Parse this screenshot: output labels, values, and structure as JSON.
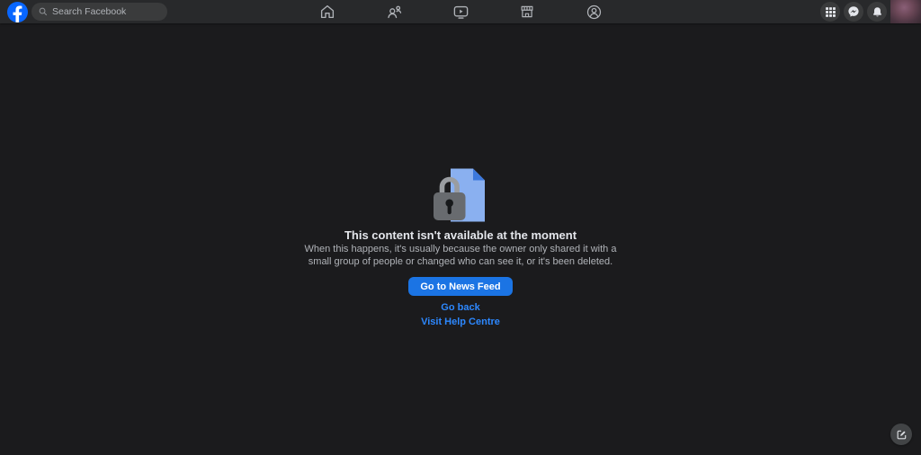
{
  "navbar": {
    "logo": "facebook",
    "search": {
      "placeholder": "Search Facebook"
    },
    "tabs": [
      {
        "icon": "home-icon"
      },
      {
        "icon": "friends-icon"
      },
      {
        "icon": "watch-icon"
      },
      {
        "icon": "marketplace-icon"
      },
      {
        "icon": "groups-icon"
      }
    ],
    "right_controls": [
      {
        "icon": "menu-grid-icon"
      },
      {
        "icon": "messenger-icon"
      },
      {
        "icon": "notifications-bell-icon"
      },
      {
        "icon": "profile-avatar"
      }
    ]
  },
  "main": {
    "illustration": "locked-document-icon",
    "title": "This content isn't available at the moment",
    "description": "When this happens, it's usually because the owner only shared it with a small group of people or changed who can see it, or it's been deleted.",
    "primary_button": "Go to News Feed",
    "link_go_back": "Go back",
    "link_help": "Visit Help Centre"
  },
  "fab": {
    "icon": "compose-post-icon"
  },
  "colors": {
    "navbar_bg": "#28292b",
    "page_bg": "#1b1b1d",
    "pill_bg": "#3a3b3c",
    "icon_gray": "#b0b3b8",
    "text_primary": "#e4e6eb",
    "text_secondary": "#b0b3b8",
    "logo_blue": "#0866ff",
    "button_blue": "#1b74e4",
    "link_blue": "#2d88ff",
    "doc_blue": "#8ab0f0",
    "doc_fold_blue": "#3c78dc",
    "lock_gray": "#686b6f"
  }
}
